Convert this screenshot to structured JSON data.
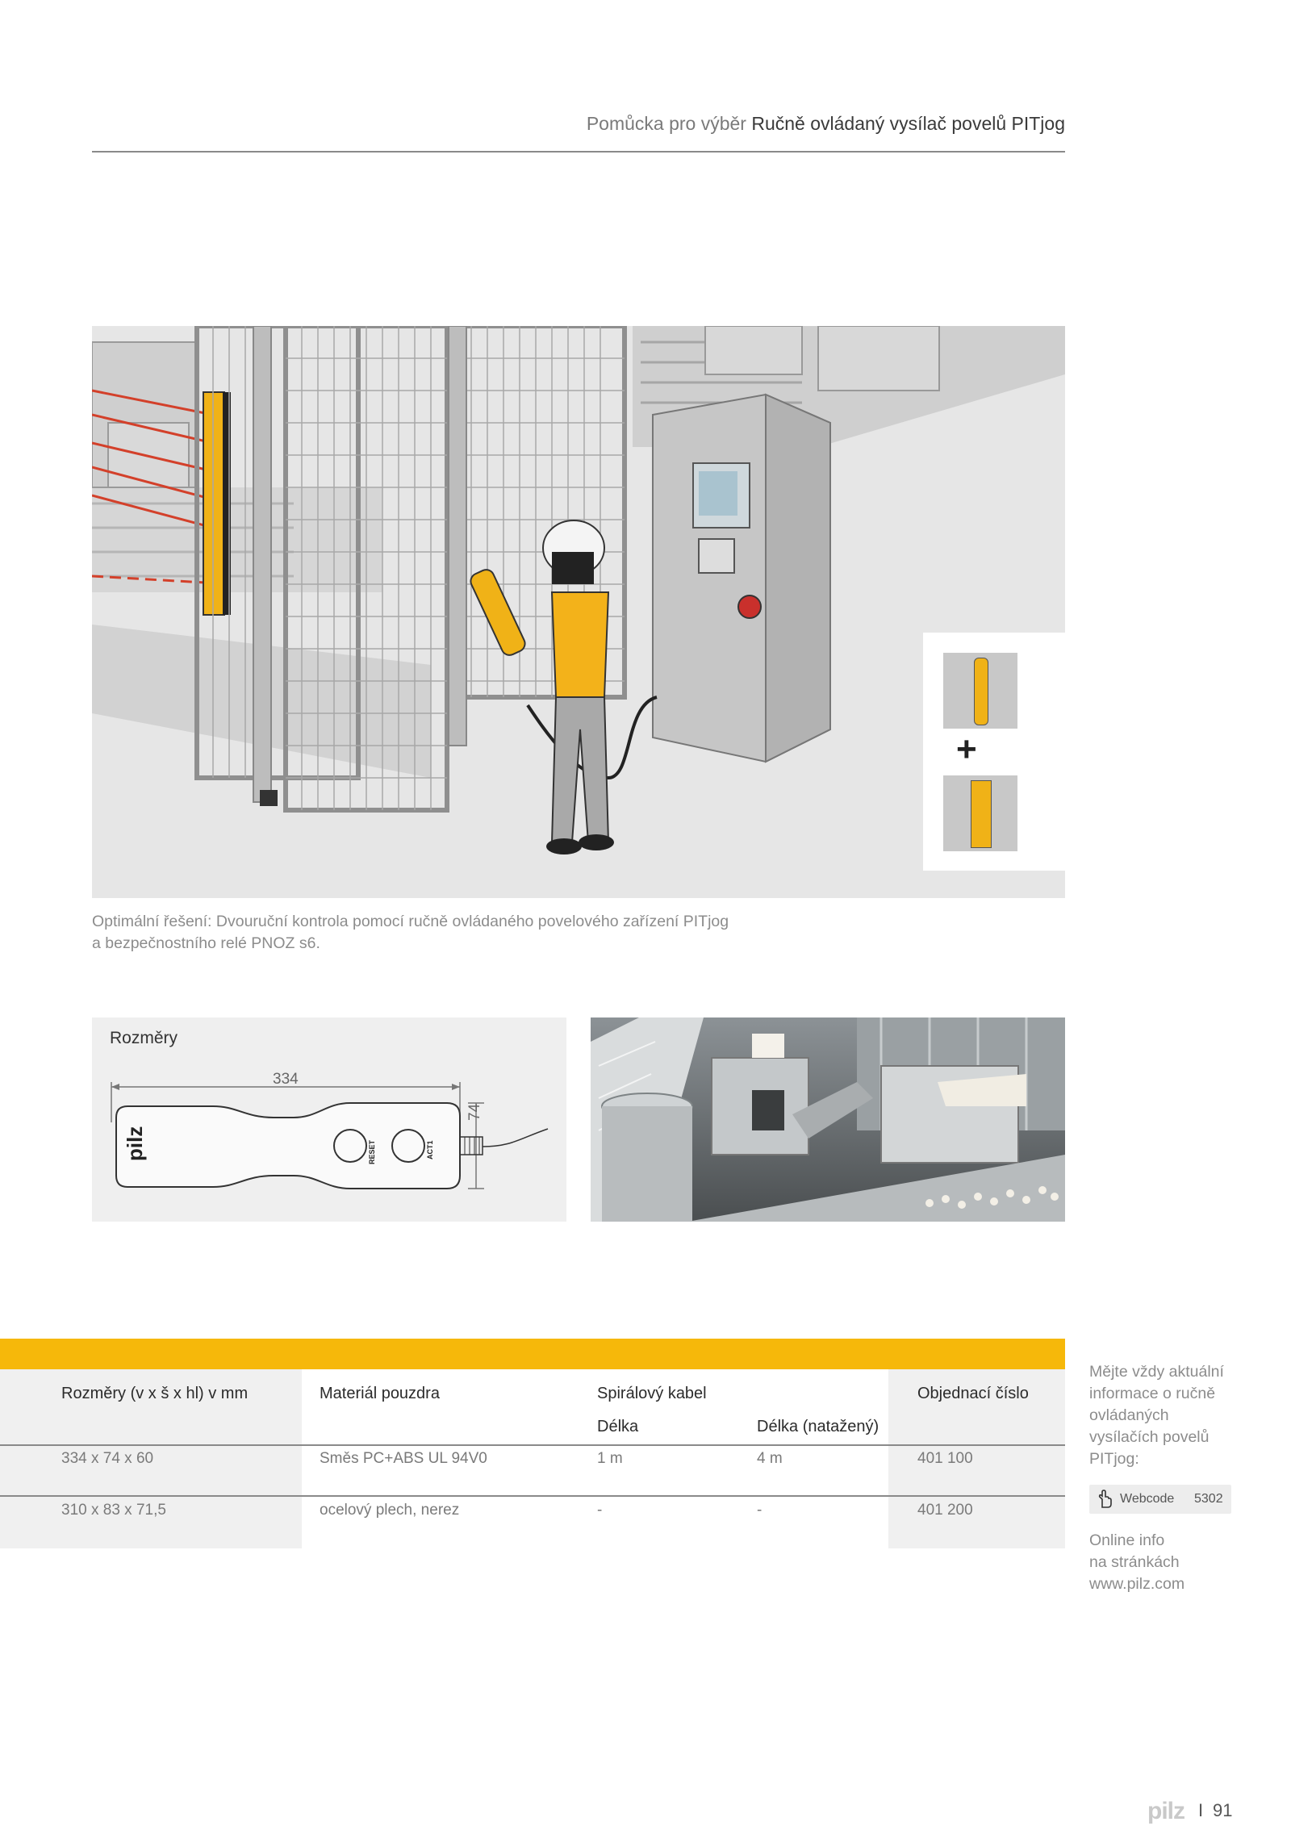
{
  "header": {
    "prefix": "Pomůcka pro výběr",
    "title": "Ručně ovládaný vysílač povelů PITjog"
  },
  "figure": {
    "caption_line1": "Optimální řešení: Dvouruční kontrola pomocí ručně ovládaného povelového zařízení PITjog",
    "caption_line2": "a bezpečnostního relé PNOZ s6.",
    "plus_symbol": "+"
  },
  "dimensions": {
    "title": "Rozměry",
    "length_value": "334",
    "height_value": "74",
    "logo_text": "pilz",
    "button1_label": "RESET",
    "button2_label": "ACT1"
  },
  "table": {
    "headers": {
      "dims": "Rozměry (v x š x hl) v mm",
      "material": "Materiál pouzdra",
      "cable": "Spirálový kabel",
      "length": "Délka",
      "length_stretched": "Délka (natažený)",
      "order": "Objednací číslo"
    },
    "rows": [
      {
        "dims": "334 x 74 x 60",
        "material": "Směs PC+ABS UL 94V0",
        "length": "1 m",
        "length_stretched": "4 m",
        "order": "401 100"
      },
      {
        "dims": "310 x 83 x 71,5",
        "material": "ocelový plech, nerez",
        "length": "-",
        "length_stretched": "-",
        "order": "401 200"
      }
    ]
  },
  "sidebar": {
    "info_lines": [
      "Mějte vždy aktuální",
      "informace o ručně",
      "ovládaných",
      "vysílačích povelů",
      "PITjog:"
    ],
    "webcode_label": "Webcode",
    "webcode_value": "5302",
    "online_lines": [
      "Online info",
      "na stránkách",
      "www.pilz.com"
    ]
  },
  "footer": {
    "logo": "pilz",
    "separator": "I",
    "page_number": "91"
  },
  "colors": {
    "accent_yellow": "#f6b80a",
    "text_grey": "#8c8c8c",
    "rule_grey": "#8a8a8a"
  }
}
